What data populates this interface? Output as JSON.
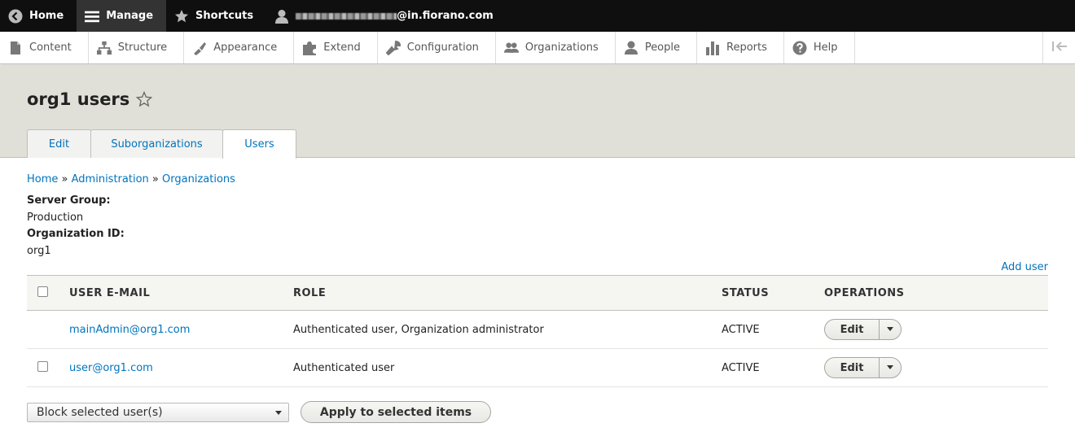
{
  "toolbar": {
    "home_label": "Home",
    "manage_label": "Manage",
    "shortcuts_label": "Shortcuts",
    "user_suffix": "@in.fiorano.com"
  },
  "tray": {
    "items": [
      {
        "label": "Content",
        "icon": "page-icon"
      },
      {
        "label": "Structure",
        "icon": "sitemap-icon"
      },
      {
        "label": "Appearance",
        "icon": "paintbrush-icon"
      },
      {
        "label": "Extend",
        "icon": "puzzle-icon"
      },
      {
        "label": "Configuration",
        "icon": "wrench-icon"
      },
      {
        "label": "Organizations",
        "icon": "people-icon"
      },
      {
        "label": "People",
        "icon": "person-icon"
      },
      {
        "label": "Reports",
        "icon": "bar-chart-icon"
      },
      {
        "label": "Help",
        "icon": "help-icon"
      }
    ]
  },
  "page": {
    "title": "org1 users",
    "tabs": [
      "Edit",
      "Suborganizations",
      "Users"
    ],
    "breadcrumb": [
      "Home",
      "Administration",
      "Organizations"
    ],
    "breadcrumb_sep": "»",
    "server_group_label": "Server Group:",
    "server_group_value": "Production",
    "org_id_label": "Organization ID:",
    "org_id_value": "org1",
    "add_user_label": "Add user"
  },
  "table": {
    "headers": {
      "email": "USER E-MAIL",
      "role": "ROLE",
      "status": "STATUS",
      "operations": "OPERATIONS"
    },
    "rows": [
      {
        "email": "mainAdmin@org1.com",
        "role": "Authenticated user, Organization administrator",
        "status": "ACTIVE",
        "op": "Edit"
      },
      {
        "email": "user@org1.com",
        "role": "Authenticated user",
        "status": "ACTIVE",
        "op": "Edit"
      }
    ]
  },
  "bulk": {
    "select_value": "Block selected user(s)",
    "apply_label": "Apply to selected items"
  }
}
